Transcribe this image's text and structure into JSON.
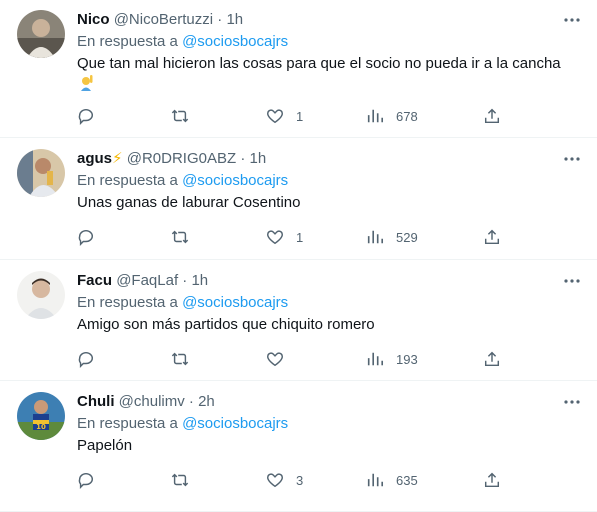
{
  "reply_prefix": "En respuesta a",
  "dot": "·",
  "tweets": [
    {
      "name": "Nico",
      "handle": "@NicoBertuzzi",
      "time": "1h",
      "replying_to": "@sociosbocajrs",
      "text": "Que tan mal hicieron las cosas para que el socio no pueda ir a la cancha",
      "emoji": "person-raising-hand",
      "likes": "1",
      "views": "678"
    },
    {
      "name": "agus",
      "name_emoji": "⚡",
      "handle": "@R0DRIG0ABZ",
      "time": "1h",
      "replying_to": "@sociosbocajrs",
      "text": "Unas ganas de laburar Cosentino",
      "likes": "1",
      "views": "529"
    },
    {
      "name": "Facu",
      "handle": "@FaqLaf",
      "time": "1h",
      "replying_to": "@sociosbocajrs",
      "text": "Amigo son más partidos que chiquito romero",
      "likes": "",
      "views": "193"
    },
    {
      "name": "Chuli",
      "handle": "@chulimv",
      "time": "2h",
      "replying_to": "@sociosbocajrs",
      "text": "Papelón",
      "likes": "3",
      "views": "635"
    }
  ],
  "colors": {
    "text": "#0f1419",
    "secondary": "#536471",
    "link": "#1d9bf0",
    "divider": "#eff3f4"
  }
}
